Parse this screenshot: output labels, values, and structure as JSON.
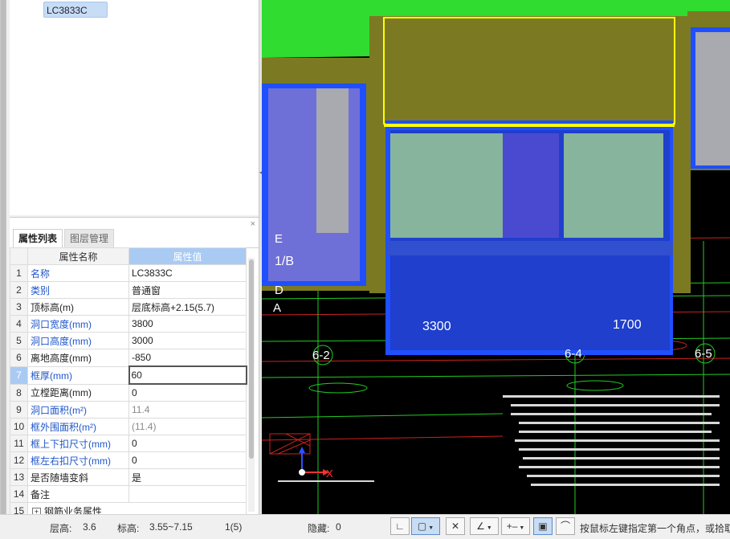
{
  "tree": {
    "selected_node": "LC3833C"
  },
  "property_panel": {
    "close_icon": "×",
    "tabs": [
      {
        "label": "属性列表"
      },
      {
        "label": "图层管理"
      }
    ],
    "columns": {
      "name": "属性名称",
      "value": "属性值"
    },
    "rows": [
      {
        "num": "1",
        "name": "名称",
        "value": "LC3833C"
      },
      {
        "num": "2",
        "name": "类别",
        "value": "普通窗"
      },
      {
        "num": "3",
        "name": "顶标高(m)",
        "value": "层底标高+2.15(5.7)"
      },
      {
        "num": "4",
        "name": "洞口宽度(mm)",
        "value": "3800"
      },
      {
        "num": "5",
        "name": "洞口高度(mm)",
        "value": "3000"
      },
      {
        "num": "6",
        "name": "离地高度(mm)",
        "value": "-850"
      },
      {
        "num": "7",
        "name": "框厚(mm)",
        "value": "60"
      },
      {
        "num": "8",
        "name": "立樘距离(mm)",
        "value": "0"
      },
      {
        "num": "9",
        "name": "洞口面积(m²)",
        "value": "11.4"
      },
      {
        "num": "10",
        "name": "框外围面积(m²)",
        "value": "(11.4)"
      },
      {
        "num": "11",
        "name": "框上下扣尺寸(mm)",
        "value": "0"
      },
      {
        "num": "12",
        "name": "框左右扣尺寸(mm)",
        "value": "0"
      },
      {
        "num": "13",
        "name": "是否随墙变斜",
        "value": "是"
      },
      {
        "num": "14",
        "name": "备注",
        "value": ""
      },
      {
        "num": "15",
        "name": "钢筋业务属性",
        "value": ""
      }
    ]
  },
  "viewport": {
    "dimensions": [
      "3300",
      "1700"
    ],
    "axis_labels": [
      "1/B",
      "6-2",
      "6-4",
      "6-5",
      "E",
      "D",
      "A"
    ],
    "axis_x_label": "X",
    "colors": {
      "wall": "#7b7a23",
      "roof": "#2fdc2f",
      "selected": "#ffff00",
      "window_frame": "#1f4fff",
      "glass": "#86b49d"
    }
  },
  "status": {
    "floor_height_label": "层高:",
    "floor_height": "3.6",
    "elevation_label": "标高:",
    "elevation": "3.55~7.15",
    "page": "1(5)",
    "hidden_label": "隐藏:",
    "hidden": "0",
    "hint": "按鼠标左键指定第一个角点，或拾取"
  }
}
